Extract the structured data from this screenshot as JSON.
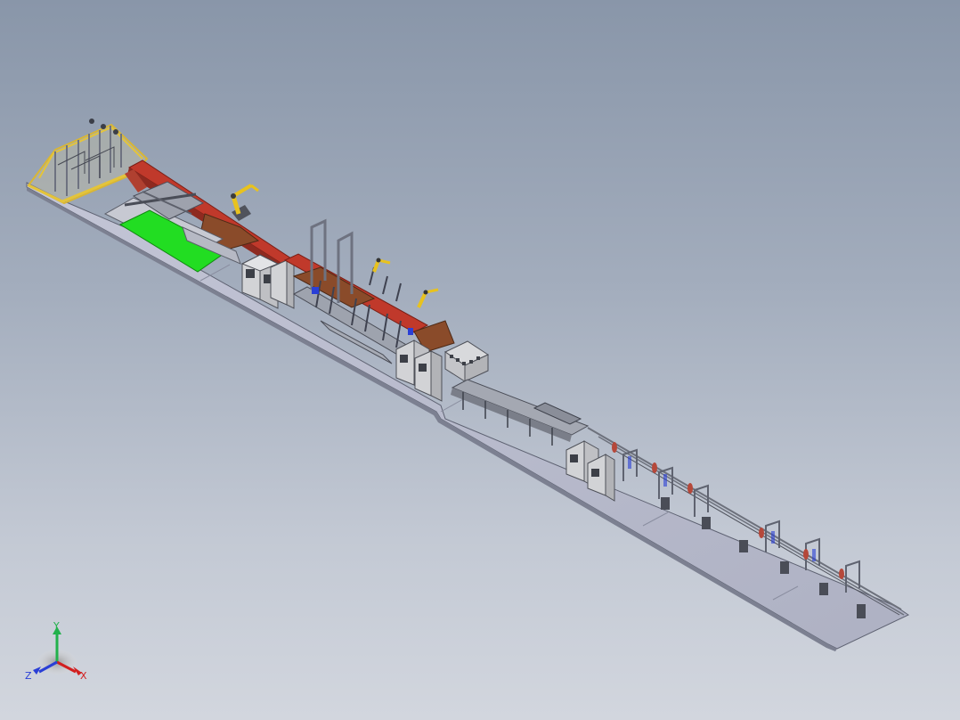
{
  "view": {
    "background_top": "#8996a9",
    "background_bottom": "#d2d6de"
  },
  "model": {
    "name": "production-line-assembly",
    "colors": {
      "floor": "#b9bccf",
      "floor_edge": "#6f7383",
      "rail_red": "#c0392b",
      "rail_brown": "#8a4b2a",
      "work_area_green": "#22dd22",
      "robot_yellow": "#e8c21e",
      "cabinet_gray": "#d2d3d6",
      "frame_yellow": "#e4c43a",
      "structure_gray": "#8e929c",
      "guard_red": "#b5483a"
    }
  },
  "triad": {
    "x_label": "X",
    "y_label": "Y",
    "z_label": "Z",
    "x_color": "#d21f1f",
    "y_color": "#22b14c",
    "z_color": "#2a3fd6"
  }
}
